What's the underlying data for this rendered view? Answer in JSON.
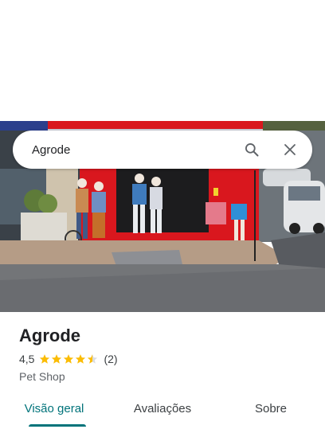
{
  "search": {
    "query": "Agrode"
  },
  "place": {
    "name": "Agrode",
    "rating": "4,5",
    "rating_value": 4.5,
    "review_count": "(2)",
    "category": "Pet Shop"
  },
  "tabs": [
    {
      "label": "Visão geral",
      "active": true
    },
    {
      "label": "Avaliações",
      "active": false
    },
    {
      "label": "Sobre",
      "active": false
    }
  ],
  "colors": {
    "accent": "#00737a",
    "star": "#fbbc04",
    "storefront": "#d9171e"
  }
}
